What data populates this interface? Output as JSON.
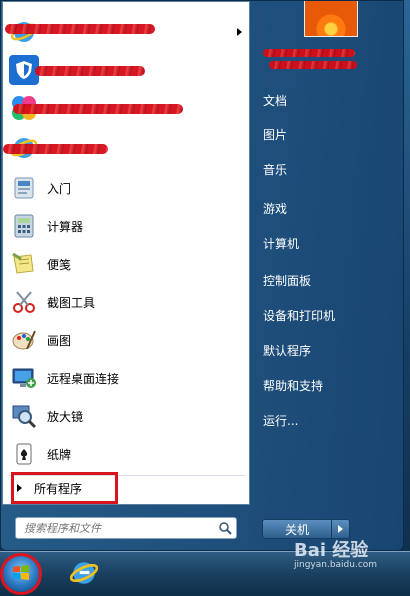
{
  "recent_programs": [
    {
      "label": "",
      "icon": "ie-icon",
      "redacted": true,
      "has_submenu_arrow": true
    },
    {
      "label": "",
      "icon": "security-manager-icon",
      "redacted": true
    },
    {
      "label": "",
      "icon": "pinwheel-icon",
      "redacted": true
    },
    {
      "label": "",
      "icon": "ie-icon",
      "redacted": true
    }
  ],
  "programs": [
    {
      "label": "入门",
      "icon": "getting-started-icon"
    },
    {
      "label": "计算器",
      "icon": "calculator-icon"
    },
    {
      "label": "便笺",
      "icon": "sticky-notes-icon"
    },
    {
      "label": "截图工具",
      "icon": "snipping-tool-icon"
    },
    {
      "label": "画图",
      "icon": "paint-icon"
    },
    {
      "label": "远程桌面连接",
      "icon": "remote-desktop-icon"
    },
    {
      "label": "放大镜",
      "icon": "magnifier-icon"
    },
    {
      "label": "纸牌",
      "icon": "solitaire-icon"
    }
  ],
  "all_programs_label": "所有程序",
  "search": {
    "placeholder": "搜索程序和文件"
  },
  "right_pane": {
    "username": "",
    "items": [
      "文档",
      "图片",
      "音乐",
      "游戏",
      "计算机",
      "控制面板",
      "设备和打印机",
      "默认程序",
      "帮助和支持",
      "运行..."
    ]
  },
  "shutdown_label": "关机",
  "watermark": {
    "main": "Bai 经验",
    "sub": "jingyan.baidu.com"
  },
  "colors": {
    "highlight_red": "#d8141f",
    "menu_blue": "#1f5484"
  }
}
